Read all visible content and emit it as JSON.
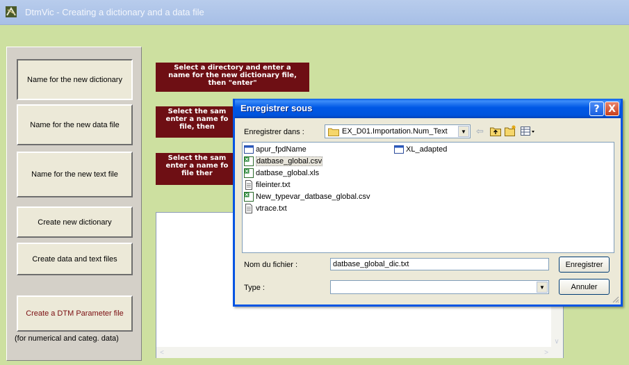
{
  "app": {
    "title": "DtmVic - Creating a dictionary and a data file",
    "icon": "dtmvic-app-icon"
  },
  "left_panel": {
    "buttons": [
      "Name for the new dictionary",
      "Name for the new data file",
      "Name for the new text file",
      "Create new dictionary",
      "Create data and text files",
      "Create a DTM Parameter file"
    ],
    "note": "(for numerical and categ. data)"
  },
  "instructions": {
    "dictionary": [
      "Select a directory and enter a",
      "name for the  new dictionary file,",
      "then \"enter\""
    ],
    "data_file": [
      "Select the sam",
      "enter a name fo",
      "file, then"
    ],
    "text_file": [
      "Select the sam",
      "enter a name fo",
      "file ther"
    ]
  },
  "dialog": {
    "title": "Enregistrer sous",
    "save_in_label": "Enregistrer dans :",
    "save_in_value": "EX_D01.Importation.Num_Text",
    "files": [
      {
        "name": "apur_fpdName",
        "icon": "window-file-icon"
      },
      {
        "name": "datbase_global.csv",
        "icon": "excel-file-icon",
        "selected": true
      },
      {
        "name": "datbase_global.xls",
        "icon": "excel-file-icon"
      },
      {
        "name": "fileinter.txt",
        "icon": "text-file-icon"
      },
      {
        "name": "New_typevar_datbase_global.csv",
        "icon": "excel-file-icon"
      },
      {
        "name": "vtrace.txt",
        "icon": "text-file-icon"
      },
      {
        "name": "XL_adapted",
        "icon": "window-file-icon"
      }
    ],
    "filename_label": "Nom du fichier :",
    "filename_value": "datbase_global_dic.txt",
    "type_label": "Type :",
    "type_value": "",
    "save_button": "Enregistrer",
    "cancel_button": "Annuler",
    "help_button": "?",
    "close_button": "X"
  },
  "colors": {
    "background": "#cde0a0",
    "instruction_bg": "#6e0f14",
    "dialog_title": "#0054e3"
  }
}
